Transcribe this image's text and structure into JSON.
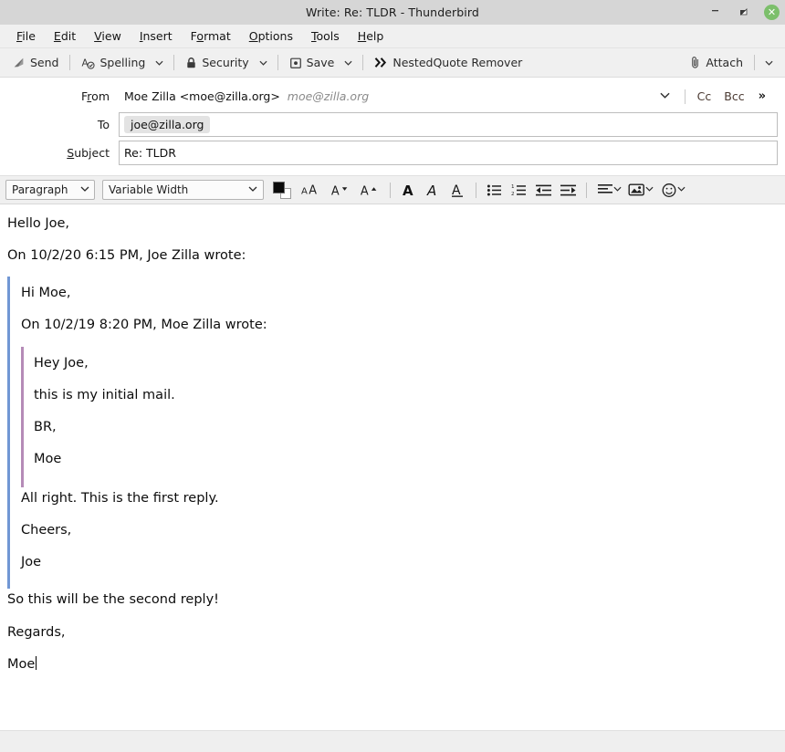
{
  "window": {
    "title": "Write: Re: TLDR - Thunderbird",
    "minimize_label": "–",
    "restore_label": "restore",
    "close_label": "✕"
  },
  "menubar": {
    "items": [
      {
        "label": "File",
        "accel": "F"
      },
      {
        "label": "Edit",
        "accel": "E"
      },
      {
        "label": "View",
        "accel": "V"
      },
      {
        "label": "Insert",
        "accel": "I"
      },
      {
        "label": "Format",
        "accel": "o"
      },
      {
        "label": "Options",
        "accel": "O"
      },
      {
        "label": "Tools",
        "accel": "T"
      },
      {
        "label": "Help",
        "accel": "H"
      }
    ]
  },
  "toolbar": {
    "send_label": "Send",
    "spelling_label": "Spelling",
    "security_label": "Security",
    "save_label": "Save",
    "nested_quote_label": "NestedQuote Remover",
    "attach_label": "Attach",
    "dropdown_caret": "⌄"
  },
  "headers": {
    "from_label": "From",
    "from_accel": "r",
    "from_value": "Moe Zilla <moe@zilla.org>",
    "from_address": "moe@zilla.org",
    "cc_label": "Cc",
    "bcc_label": "Bcc",
    "more_label": "»",
    "to_label": "To",
    "to_value": "joe@zilla.org",
    "subject_label": "Subject",
    "subject_accel": "S",
    "subject_value": "Re: TLDR"
  },
  "formatbar": {
    "paragraph_style": "Paragraph",
    "font_face": "Variable Width",
    "bold_label": "A",
    "italic_label": "A",
    "underline_label": "A",
    "font_size_both": "AA",
    "font_size_smaller": "A",
    "font_size_larger": "A"
  },
  "body": {
    "greeting": "Hello Joe,",
    "attribution1": "On 10/2/20 6:15 PM, Joe Zilla wrote:",
    "quote1": {
      "greeting": "Hi Moe,",
      "attribution2": "On 10/2/19 8:20 PM, Moe Zilla wrote:",
      "quote2": {
        "greeting": "Hey Joe,",
        "line1": "this is my initial mail.",
        "signoff": "BR,",
        "signature": "Moe"
      },
      "reply": "All right. This is the first reply.",
      "signoff": "Cheers,",
      "signature": "Joe"
    },
    "reply": "So this will be the second reply!",
    "signoff": "Regards,",
    "signature": "Moe"
  },
  "colors": {
    "titlebar": "#d6d6d6",
    "chrome": "#f0f0f0",
    "close_button": "#7cbf6b",
    "quote_level1": "#7197d4",
    "quote_level2": "#b58bb7",
    "pill_background": "#e3e3e3"
  }
}
